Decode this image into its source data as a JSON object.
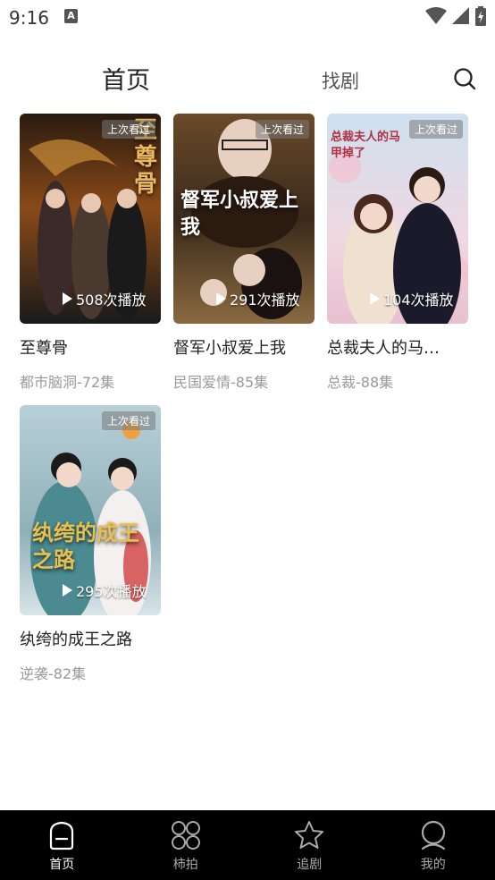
{
  "status_bar": {
    "time": "9:16",
    "notification_icon": "A"
  },
  "header": {
    "tab_home": "首页",
    "tab_find": "找剧",
    "search_icon": "search-icon"
  },
  "cards": [
    {
      "title": "至尊骨",
      "meta": "都市脑洞-72集",
      "plays": "508次播放",
      "badge": "上次看过",
      "poster_text": "至尊骨"
    },
    {
      "title": "督军小叔爱上我",
      "meta": "民国爱情-85集",
      "plays": "291次播放",
      "badge": "上次看过",
      "poster_text": "督军小叔爱上我"
    },
    {
      "title": "总裁夫人的马…",
      "meta": "总裁-88集",
      "plays": "104次播放",
      "badge": "上次看过",
      "poster_text": "总裁夫人的马甲掉了"
    },
    {
      "title": "纨绔的成王之路",
      "meta": "逆袭-82集",
      "plays": "295次播放",
      "badge": "上次看过",
      "poster_text": "纨绔的成王之路"
    }
  ],
  "bottom_nav": [
    {
      "label": "首页",
      "icon": "home-icon",
      "active": true
    },
    {
      "label": "柿拍",
      "icon": "grid-icon",
      "active": false
    },
    {
      "label": "追剧",
      "icon": "star-icon",
      "active": false
    },
    {
      "label": "我的",
      "icon": "profile-icon",
      "active": false
    }
  ],
  "colors": {
    "nav_bg": "#000000",
    "nav_active": "#ffffff",
    "nav_inactive": "#aaaaaa",
    "meta_text": "#999999"
  }
}
